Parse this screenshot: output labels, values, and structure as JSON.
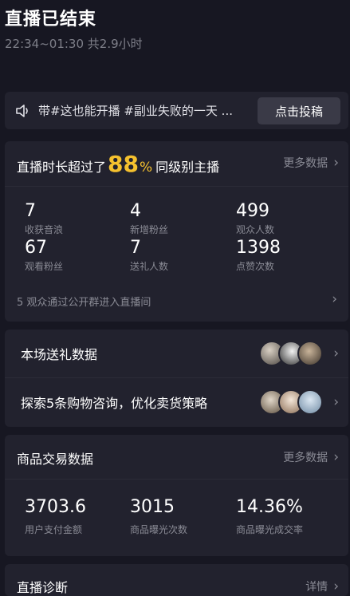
{
  "header": {
    "title": "直播已结束",
    "subtitle": "22:34~01:30 共2.9小时"
  },
  "promo": {
    "icon": "speaker-icon",
    "text": "带#这也能开播 #副业失败的一天 ...",
    "button_label": "点击投稿"
  },
  "stats": {
    "headline_prefix": "直播时长超过了",
    "headline_percent": "88",
    "headline_percent_sign": "%",
    "headline_suffix": "同级别主播",
    "more_label": "更多数据",
    "metrics": [
      {
        "value": "7",
        "label": "收获音浪"
      },
      {
        "value": "4",
        "label": "新增粉丝"
      },
      {
        "value": "499",
        "label": "观众人数"
      },
      {
        "value": "67",
        "label": "观看粉丝"
      },
      {
        "value": "7",
        "label": "送礼人数"
      },
      {
        "value": "1398",
        "label": "点赞次数"
      }
    ],
    "footer": "5 观众通过公开群进入直播间"
  },
  "rows": {
    "gifts_label": "本场送礼数据",
    "shopping_label": "探索5条购物咨询，优化卖货策略"
  },
  "goods": {
    "title": "商品交易数据",
    "more_label": "更多数据",
    "metrics": [
      {
        "value": "3703.6",
        "label": "用户支付金额"
      },
      {
        "value": "3015",
        "label": "商品曝光次数"
      },
      {
        "value": "14.36%",
        "label": "商品曝光成交率"
      }
    ]
  },
  "diagnosis": {
    "title": "直播诊断",
    "more_label": "详情"
  },
  "colors": {
    "background": "#171722",
    "card": "#22222e",
    "accent": "#f5c12e",
    "muted_text": "#8a8b95"
  }
}
